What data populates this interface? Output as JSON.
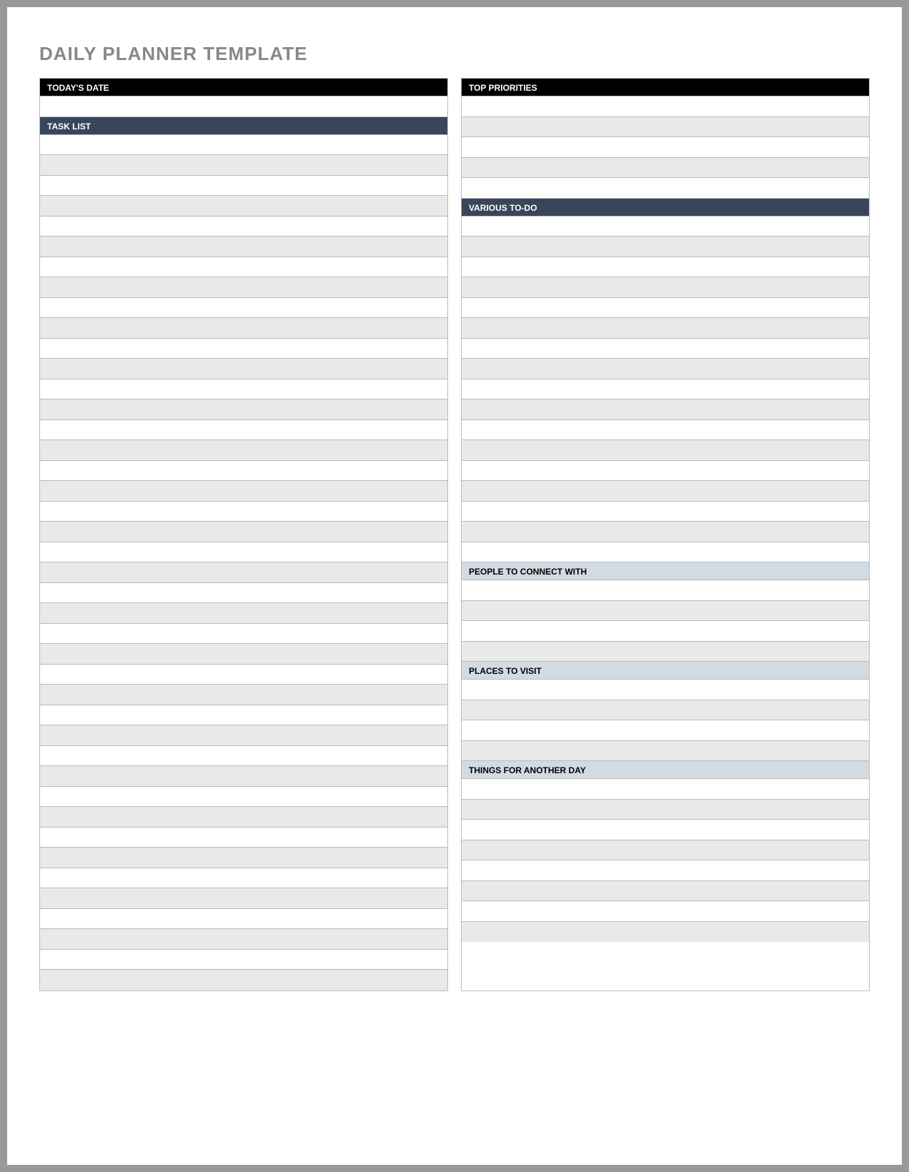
{
  "title": "DAILY PLANNER TEMPLATE",
  "left": {
    "todays_date": "TODAY'S DATE",
    "task_list": "TASK LIST"
  },
  "right": {
    "top_priorities": "TOP PRIORITIES",
    "various_todo": "VARIOUS TO-DO",
    "people_to_connect": "PEOPLE TO CONNECT WITH",
    "places_to_visit": "PLACES TO VISIT",
    "things_for_another_day": "THINGS FOR ANOTHER DAY"
  }
}
